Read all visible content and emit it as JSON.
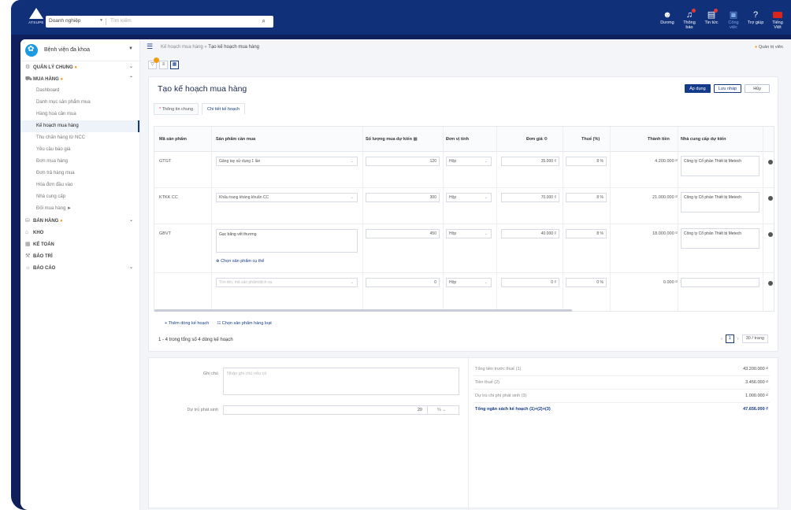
{
  "topbar": {
    "brand": "ATSUPE",
    "search_scope": "Doanh nghiệp",
    "search_placeholder": "Tìm kiếm",
    "icons": [
      {
        "label": "Dương"
      },
      {
        "label": "Thông báo"
      },
      {
        "label": "Tin tức"
      },
      {
        "label": "Công việc"
      },
      {
        "label": "Trợ giúp"
      },
      {
        "label": "Tiếng Việt"
      }
    ]
  },
  "sidebar": {
    "org_name": "Bệnh viện đa khoa",
    "items": [
      {
        "label": "QUẢN LÝ CHUNG",
        "dot": "●"
      },
      {
        "label": "MUA HÀNG",
        "dot": "●"
      },
      {
        "label": "Dashboard"
      },
      {
        "label": "Danh mục sản phẩm mua"
      },
      {
        "label": "Hàng hoá cần mua"
      },
      {
        "label": "Kế hoạch mua hàng"
      },
      {
        "label": "Thu chấn hàng từ NCC"
      },
      {
        "label": "Yêu cầu báo giá"
      },
      {
        "label": "Đơn mua hàng"
      },
      {
        "label": "Đơn trả hàng mua"
      },
      {
        "label": "Hóa đơn đầu vào"
      },
      {
        "label": "Nhà cung cấp"
      },
      {
        "label": "Đối mua hàng ►"
      },
      {
        "label": "BÁN HÀNG",
        "dot": "●"
      },
      {
        "label": "KHO"
      },
      {
        "label": "KẾ TOÁN"
      },
      {
        "label": "BẢO TRÌ"
      },
      {
        "label": "BÁO CÁO"
      }
    ]
  },
  "breadcrumb": {
    "parent": "Kế hoạch mua hàng",
    "sep": "»",
    "current": "Tạo kế hoạch mua hàng"
  },
  "admin": {
    "dot": "●",
    "label": "Quản trị viên"
  },
  "page": {
    "title": "Tạo kế hoạch mua hàng",
    "apply": "Áp dụng",
    "save_draft": "Lưu nháp",
    "cancel": "Hủy"
  },
  "tabs": [
    {
      "req": "*",
      "label": "Thông tin chung"
    },
    {
      "label": "Chi tiết kế hoạch"
    }
  ],
  "table": {
    "headers": [
      "Mã sản phẩm",
      "Sản phẩm cần mua",
      "Số lượng mua dự kiến",
      "Đơn vị tính",
      "Đơn giá",
      "Thuế (%)",
      "Thành tiền",
      "Nhà cung cấp dự kiến"
    ],
    "rows": [
      {
        "code": "GTGT",
        "product": "Găng tay sử dụng 1 lần",
        "qty": "120",
        "unit": "Hộp",
        "price": "35.000",
        "currency": "₫",
        "tax": "8",
        "pct": "%",
        "amount": "4.200.000 ₫",
        "supplier": "Công ty Cổ phần Thiết bị Metech"
      },
      {
        "code": "KTKK CC",
        "product": "Khẩu trang kháng khuẩn CC",
        "qty": "300",
        "unit": "Hộp",
        "price": "70.000",
        "currency": "₫",
        "tax": "8",
        "pct": "%",
        "amount": "21.000.000 ₫",
        "supplier": "Công ty Cổ phần Thiết bị Metech"
      },
      {
        "code": "GBVT",
        "product": "Gạc băng vết thương",
        "qty": "450",
        "unit": "Hộp",
        "price": "40.000",
        "currency": "₫",
        "tax": "8",
        "pct": "%",
        "amount": "18.000.000 ₫",
        "supplier": "Công ty Cổ phần Thiết bị Metech"
      },
      {
        "code": "",
        "product": "Tìm tên, mã sản phẩm/dịch vụ",
        "qty": "0",
        "unit": "Hộp",
        "price": "0",
        "currency": "₫",
        "tax": "0",
        "pct": "%",
        "amount": "0.000 ₫",
        "supplier": ""
      }
    ],
    "choose_specific": "Chọn sản phẩm cụ thể"
  },
  "footer_links": {
    "add_line": "+ Thêm dòng kế hoạch",
    "choose_bulk": "Chọn sản phẩm hàng loạt"
  },
  "count_text": "1 - 4 trong tổng số 4 dòng kế hoạch",
  "pager": {
    "prev": "‹",
    "current": "1",
    "next": "›",
    "page_size": "30 / trang"
  },
  "form": {
    "note_label": "Ghi chú",
    "note_placeholder": "Nhập ghi chú nếu có",
    "reserve_label": "Dự trù phát sinh",
    "reserve_value": "20",
    "reserve_unit": "%"
  },
  "summary": [
    {
      "label": "Tổng tiền trước thuế (1)",
      "value": "43.200.000 ₫"
    },
    {
      "label": "Tiền thuế (2)",
      "value": "3.456.000 ₫"
    },
    {
      "label": "Dự trù chi phí phát sinh (3)",
      "value": "1.000.000 ₫"
    },
    {
      "label": "Tổng ngân sách kế hoạch (1)+(2)+(3)",
      "value": "47.656.000 ₫",
      "total": true
    }
  ],
  "colors": {
    "brand": "#10307a",
    "accent": "#143a8a",
    "warning": "#f39c12",
    "danger": "#e53935"
  }
}
